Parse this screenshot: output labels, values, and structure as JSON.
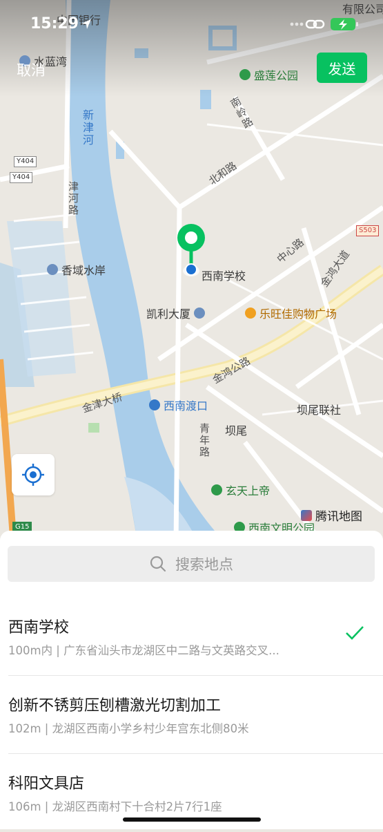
{
  "status_bar": {
    "time": "15:29"
  },
  "header": {
    "cancel_label": "取消",
    "send_label": "发送"
  },
  "map": {
    "labels": {
      "bank": "中国银行",
      "corner_company": "有限公司",
      "shuilanwan": "水蓝湾",
      "shenglian_park": "盛莲公园",
      "xinjin_river": "新津河",
      "nanling_road": "南岭路",
      "beihe_road": "北和路",
      "jinhe_road": "津河路",
      "xiangyu": "香域水岸",
      "zhongxin_road": "中心路",
      "jinhong_avenue": "金鸿大道",
      "selected_place": "西南学校",
      "kaili": "凯利大厦",
      "lewang": "乐旺佳购物广场",
      "jinhong_road": "金鸿公路",
      "jinjin_bridge": "金津大桥",
      "ferry": "西南渡口",
      "bawei_lianshe": "坝尾联社",
      "bawei": "坝尾",
      "qingnian_road": "青年路",
      "xuantian": "玄天上帝",
      "wenming_park": "西南文明公园",
      "tencent_map": "腾讯地图",
      "y404_a": "Y404",
      "y404_b": "Y404",
      "s503": "S503",
      "g15": "G15"
    }
  },
  "search": {
    "placeholder": "搜索地点"
  },
  "results": [
    {
      "title": "西南学校",
      "subtitle": "100m内 | 广东省汕头市龙湖区中二路与文英路交叉...",
      "selected": true
    },
    {
      "title": "创新不锈剪压刨槽激光切割加工",
      "subtitle": "102m | 龙湖区西南小学乡村少年宫东北侧80米",
      "selected": false
    },
    {
      "title": "科阳文具店",
      "subtitle": "106m | 龙湖区西南村下十合村2片7行1座",
      "selected": false
    }
  ],
  "colors": {
    "accent": "#07c160",
    "water": "#a9cdea",
    "pin_blue": "#1a6fd1"
  }
}
